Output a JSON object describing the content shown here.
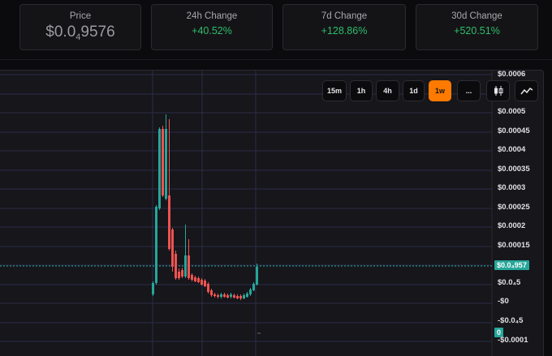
{
  "stats": {
    "price": {
      "label": "Price",
      "prefix": "$0.0",
      "zeros": "4",
      "digits": "9576"
    },
    "change_24h": {
      "label": "24h Change",
      "value": "+40.52%"
    },
    "change_7d": {
      "label": "7d Change",
      "value": "+128.86%"
    },
    "change_30d": {
      "label": "30d Change",
      "value": "+520.51%"
    }
  },
  "chart": {
    "intervals": [
      "15m",
      "1h",
      "4h",
      "1d",
      "1w"
    ],
    "active_interval": "1w",
    "more_label": "...",
    "icons": [
      "candlestick-icon",
      "line-chart-icon"
    ],
    "y_axis_labels": [
      "$0.0006",
      "$0.0005",
      "$0.00045",
      "$0.0004",
      "$0.00035",
      "$0.0003",
      "$0.00025",
      "$0.0002",
      "$0.00015",
      "-$0",
      "-$0.0001"
    ],
    "current_price_badge": "$0.0₄957",
    "axis_tick_5e5": "$0.0₄5",
    "axis_tick_neg_5e5": "-$0.0₄5",
    "zero_badge": "0",
    "colors": {
      "up": "#26a69a",
      "down": "#ef5350",
      "accent": "#ff7a00",
      "positive_text": "#2ebd6b"
    }
  }
}
